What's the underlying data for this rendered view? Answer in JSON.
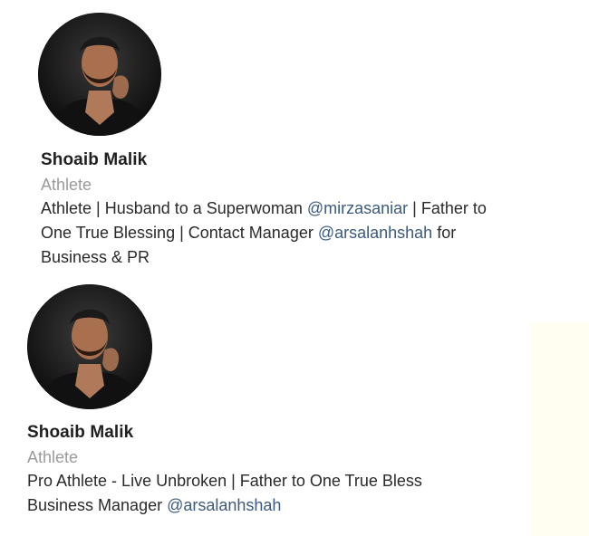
{
  "profiles": [
    {
      "avatar_icon": "profile-photo",
      "name": "Shoaib Malik",
      "category": "Athlete",
      "bio_line1_a": "Athlete | Husband to a Superwoman ",
      "bio_line1_mention": "@mirzasaniar",
      "bio_line1_b": " | Father to",
      "bio_line2_a": "One True Blessing | Contact Manager ",
      "bio_line2_mention": "@arsalanhshah",
      "bio_line2_b": " for",
      "bio_line3": "Business & PR"
    },
    {
      "avatar_icon": "profile-photo",
      "name": "Shoaib Malik",
      "category": "Athlete",
      "bio_line1": "Pro Athlete - Live Unbroken | Father to One True Bless",
      "bio_line2_a": "Business Manager ",
      "bio_line2_mention": "@arsalanhshah"
    }
  ],
  "colors": {
    "mention": "#3b5a7e",
    "category": "#9a9a9a",
    "strip": "#fffef0"
  }
}
